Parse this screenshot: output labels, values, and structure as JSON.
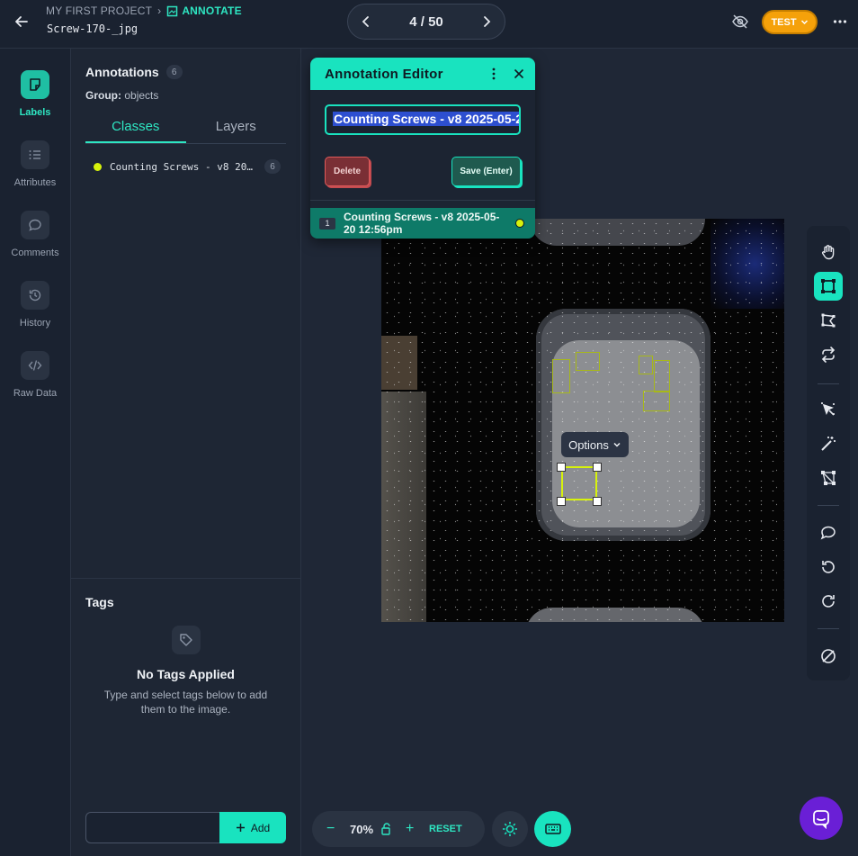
{
  "header": {
    "project": "MY FIRST PROJECT",
    "section": "ANNOTATE",
    "filename": "Screw-170-_jpg",
    "pager": "4 / 50",
    "env_badge": "TEST"
  },
  "rail": {
    "items": [
      {
        "label": "Labels",
        "icon": "sticky-note-icon",
        "active": true
      },
      {
        "label": "Attributes",
        "icon": "list-icon"
      },
      {
        "label": "Comments",
        "icon": "chat-bubble-icon"
      },
      {
        "label": "History",
        "icon": "history-icon"
      },
      {
        "label": "Raw Data",
        "icon": "code-icon"
      }
    ]
  },
  "panel": {
    "title": "Annotations",
    "count": "6",
    "group_label": "Group:",
    "group_value": "objects",
    "tabs": [
      "Classes",
      "Layers"
    ],
    "class_row": {
      "name": "Counting Screws - v8 2025-05-20 12:56pm",
      "count": "6",
      "color": "#d7f20c"
    },
    "tags": {
      "title": "Tags",
      "empty_title": "No Tags Applied",
      "empty_text": "Type and select tags below to add them to the image.",
      "input_value": "",
      "add_label": "Add"
    }
  },
  "editor": {
    "title": "Annotation Editor",
    "class_value": "Counting Screws - v8 2025-05-2",
    "delete_label": "Delete",
    "save_label": "Save (Enter)",
    "row_index": "1",
    "row_label": "Counting Screws - v8 2025-05-20 12:56pm"
  },
  "canvas": {
    "options_label": "Options"
  },
  "toolbar": {
    "tools": [
      "hand-icon",
      "bounding-box-icon",
      "polygon-icon",
      "repeat-icon",
      "smart-select-icon",
      "magic-wand-icon",
      "keypoints-icon",
      "comment-icon",
      "undo-icon",
      "redo-icon",
      "hide-icon"
    ],
    "active": "bounding-box-icon"
  },
  "zoom": {
    "minus": "−",
    "value": "70%",
    "plus": "+",
    "reset": "RESET"
  },
  "colors": {
    "accent": "#19e3bf",
    "annotation": "#d7f20c",
    "badge": "#f5a10a",
    "chat": "#6a1fd6"
  }
}
